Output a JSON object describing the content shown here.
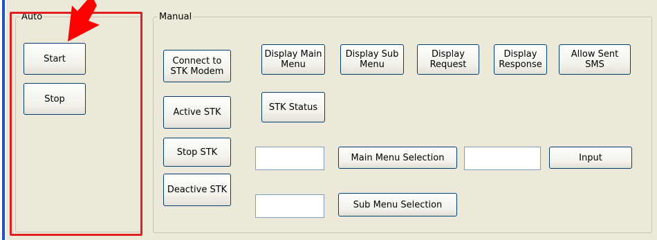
{
  "auto": {
    "legend": "Auto",
    "start_label": "Start",
    "stop_label": "Stop"
  },
  "manual": {
    "legend": "Manual",
    "connect_label": "Connect to STK Modem",
    "active_stk_label": "Active STK",
    "stop_stk_label": "Stop STK",
    "deactive_stk_label": "Deactive STK",
    "display_main_menu_label": "Display Main Menu",
    "display_sub_menu_label": "Display Sub Menu",
    "display_request_label": "Display Request",
    "display_response_label": "Display Response",
    "allow_sent_sms_label": "Allow Sent SMS",
    "stk_status_label": "STK Status",
    "main_menu_selection_label": "Main Menu Selection",
    "sub_menu_selection_label": "Sub Menu Selection",
    "input_label": "Input",
    "main_menu_selection_value": "",
    "sub_menu_selection_value": "",
    "input_value": ""
  },
  "annotation": {
    "highlight_color": "#e02020",
    "arrow_color": "#ff0000"
  }
}
